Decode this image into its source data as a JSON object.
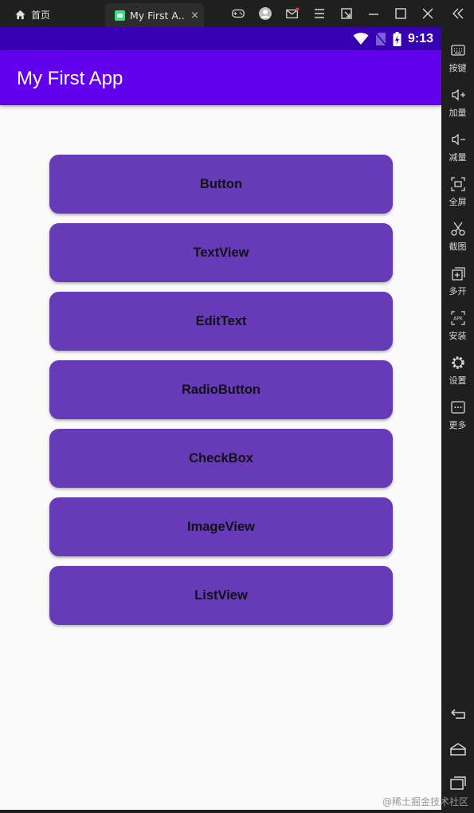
{
  "emulator": {
    "home_tab_label": "首页",
    "app_tab_label": "My First A...",
    "app_tab_close": "×"
  },
  "status_bar": {
    "time": "9:13",
    "colors": {
      "status": "#3700b3",
      "app_bar": "#6200ee",
      "button": "#673ab7"
    }
  },
  "app": {
    "title": "My First App",
    "buttons": [
      {
        "label": "Button"
      },
      {
        "label": "TextView"
      },
      {
        "label": "EditText"
      },
      {
        "label": "RadioButton"
      },
      {
        "label": "CheckBox"
      },
      {
        "label": "ImageView"
      },
      {
        "label": "ListView"
      }
    ]
  },
  "side_panel": {
    "items": [
      {
        "label": "按键",
        "icon": "keyboard-icon"
      },
      {
        "label": "加量",
        "icon": "volume-up-icon"
      },
      {
        "label": "减量",
        "icon": "volume-down-icon"
      },
      {
        "label": "全屏",
        "icon": "fullscreen-icon"
      },
      {
        "label": "截图",
        "icon": "scissors-icon"
      },
      {
        "label": "多开",
        "icon": "multi-open-icon"
      },
      {
        "label": "安装",
        "icon": "apk-icon"
      },
      {
        "label": "设置",
        "icon": "gear-icon"
      },
      {
        "label": "更多",
        "icon": "more-icon"
      }
    ],
    "nav": [
      "back-icon",
      "home-icon",
      "recents-icon"
    ]
  },
  "watermark": "@稀土掘金技术社区"
}
